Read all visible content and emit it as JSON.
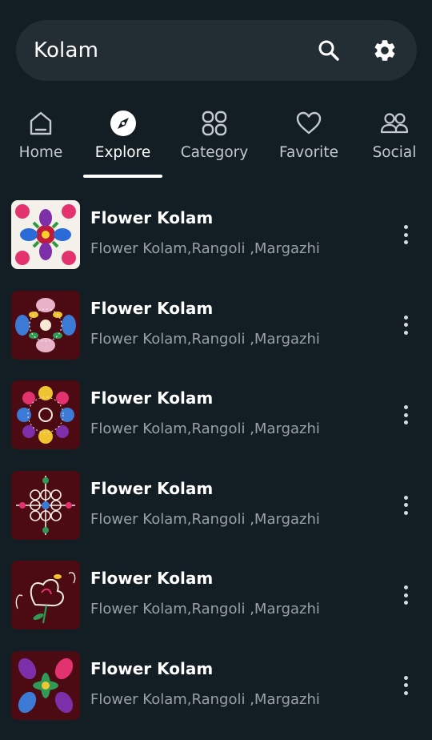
{
  "search": {
    "title": "Kolam",
    "search_icon": "search-icon",
    "settings_icon": "gear-icon"
  },
  "tabs": [
    {
      "label": "Home",
      "icon": "home-icon"
    },
    {
      "label": "Explore",
      "icon": "compass-icon",
      "active": true
    },
    {
      "label": "Category",
      "icon": "grid-icon"
    },
    {
      "label": "Favorite",
      "icon": "heart-icon"
    },
    {
      "label": "Social",
      "icon": "people-icon"
    }
  ],
  "items": [
    {
      "title": "Flower Kolam",
      "subtitle": "Flower Kolam,Rangoli ,Margazhi"
    },
    {
      "title": "Flower Kolam",
      "subtitle": "Flower Kolam,Rangoli ,Margazhi"
    },
    {
      "title": "Flower Kolam",
      "subtitle": "Flower Kolam,Rangoli ,Margazhi"
    },
    {
      "title": "Flower Kolam",
      "subtitle": "Flower Kolam,Rangoli ,Margazhi"
    },
    {
      "title": "Flower Kolam",
      "subtitle": "Flower Kolam,Rangoli ,Margazhi"
    },
    {
      "title": "Flower Kolam",
      "subtitle": "Flower Kolam,Rangoli ,Margazhi"
    }
  ],
  "colors": {
    "background": "#131d24",
    "search_bg": "#232d34",
    "subtitle": "#9aa1a6",
    "thumb_bg": "#4a0c12"
  }
}
